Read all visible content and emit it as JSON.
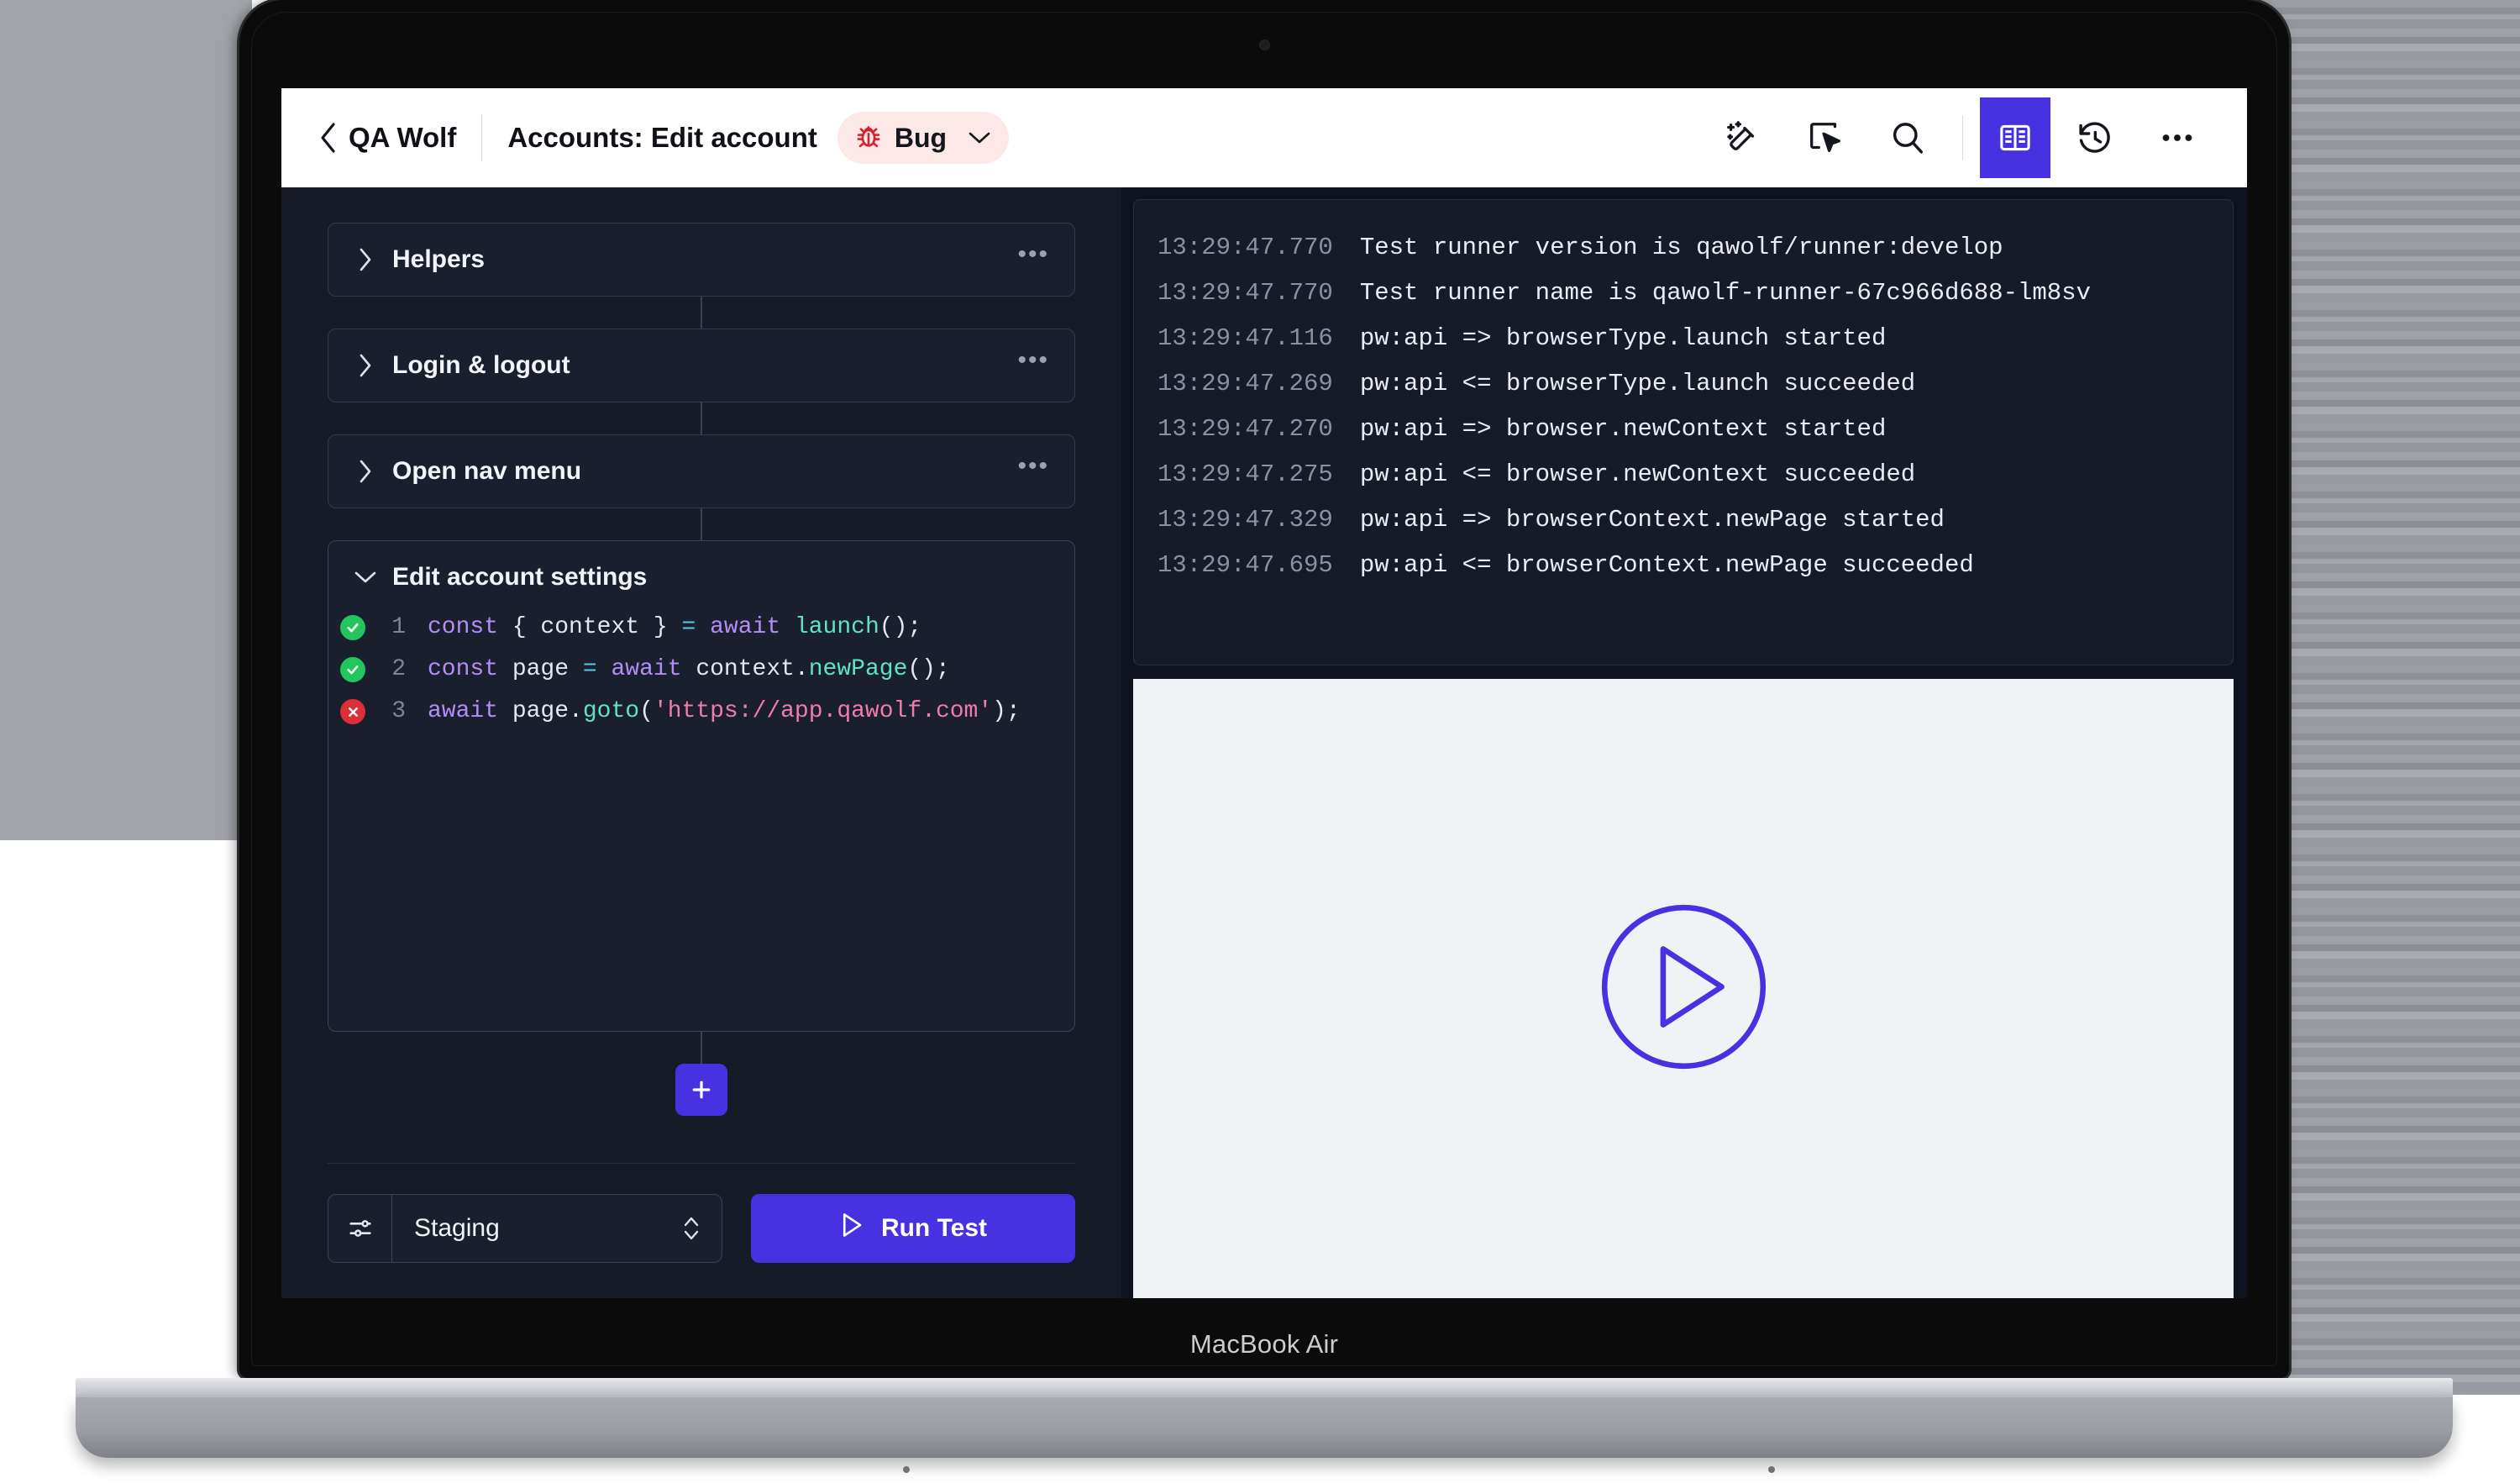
{
  "device": {
    "label": "MacBook Air"
  },
  "header": {
    "back_icon": "chevron-left-icon",
    "brand": "QA Wolf",
    "page_title": "Accounts: Edit account",
    "badge": {
      "label": "Bug",
      "icon": "bug-icon",
      "bg_color": "#fde8e8",
      "icon_color": "#d42231",
      "chevron_icon": "chevron-down-icon"
    },
    "tools": [
      {
        "name": "magic-wand-icon",
        "active": false
      },
      {
        "name": "select-element-icon",
        "active": false
      },
      {
        "name": "search-icon",
        "active": false
      },
      {
        "name": "panels-icon",
        "active": true
      },
      {
        "name": "history-icon",
        "active": false
      },
      {
        "name": "more-options-icon",
        "active": false
      }
    ],
    "accent_color": "#4731e0"
  },
  "editor": {
    "steps": [
      {
        "title": "Helpers",
        "expanded": false,
        "more_label": "•••"
      },
      {
        "title": "Login & logout",
        "expanded": false,
        "more_label": "•••"
      },
      {
        "title": "Open nav menu",
        "expanded": false,
        "more_label": "•••"
      }
    ],
    "expanded_step": {
      "title": "Edit account settings",
      "lines": [
        {
          "number": "1",
          "status": "pass",
          "tokens": [
            {
              "t": "const",
              "c": "kw"
            },
            {
              "t": " ",
              "c": "pun"
            },
            {
              "t": "{ context }",
              "c": "pun"
            },
            {
              "t": " ",
              "c": "pun"
            },
            {
              "t": "=",
              "c": "op"
            },
            {
              "t": " ",
              "c": "pun"
            },
            {
              "t": "await",
              "c": "kw"
            },
            {
              "t": " ",
              "c": "pun"
            },
            {
              "t": "launch",
              "c": "fn"
            },
            {
              "t": "();",
              "c": "pun"
            }
          ]
        },
        {
          "number": "2",
          "status": "pass",
          "tokens": [
            {
              "t": "const",
              "c": "kw"
            },
            {
              "t": " ",
              "c": "pun"
            },
            {
              "t": "page",
              "c": "var"
            },
            {
              "t": " ",
              "c": "pun"
            },
            {
              "t": "=",
              "c": "op"
            },
            {
              "t": " ",
              "c": "pun"
            },
            {
              "t": "await",
              "c": "kw"
            },
            {
              "t": " ",
              "c": "pun"
            },
            {
              "t": "context",
              "c": "var"
            },
            {
              "t": ".",
              "c": "pun"
            },
            {
              "t": "newPage",
              "c": "prop"
            },
            {
              "t": "();",
              "c": "pun"
            }
          ]
        },
        {
          "number": "3",
          "status": "fail",
          "tokens": [
            {
              "t": "await",
              "c": "kw"
            },
            {
              "t": " ",
              "c": "pun"
            },
            {
              "t": "page",
              "c": "var"
            },
            {
              "t": ".",
              "c": "pun"
            },
            {
              "t": "goto",
              "c": "prop"
            },
            {
              "t": "(",
              "c": "pun"
            },
            {
              "t": "'https://app.qawolf.com'",
              "c": "str"
            },
            {
              "t": ");",
              "c": "pun"
            }
          ]
        }
      ]
    },
    "add_step_button": {
      "label": "+",
      "name": "add-step-button"
    },
    "footer": {
      "environment": {
        "value": "Staging",
        "icon": "sliders-icon",
        "caret_icon": "chevron-updown-icon"
      },
      "run_button": {
        "label": "Run Test",
        "icon": "play-icon"
      }
    }
  },
  "console": {
    "lines": [
      {
        "ts": "13:29:47.770",
        "msg": "Test runner version is qawolf/runner:develop"
      },
      {
        "ts": "13:29:47.770",
        "msg": "Test runner name is qawolf-runner-67c966d688-lm8sv"
      },
      {
        "ts": "13:29:47.116",
        "msg": "pw:api => browserType.launch started"
      },
      {
        "ts": "13:29:47.269",
        "msg": "pw:api <= browserType.launch succeeded"
      },
      {
        "ts": "13:29:47.270",
        "msg": "pw:api => browser.newContext started"
      },
      {
        "ts": "13:29:47.275",
        "msg": "pw:api <= browser.newContext succeeded"
      },
      {
        "ts": "13:29:47.329",
        "msg": "pw:api => browserContext.newPage started"
      },
      {
        "ts": "13:29:47.695",
        "msg": "pw:api <= browserContext.newPage succeeded"
      }
    ]
  },
  "preview": {
    "play_icon": "play-circle-icon",
    "accent_color": "#4731e0"
  }
}
